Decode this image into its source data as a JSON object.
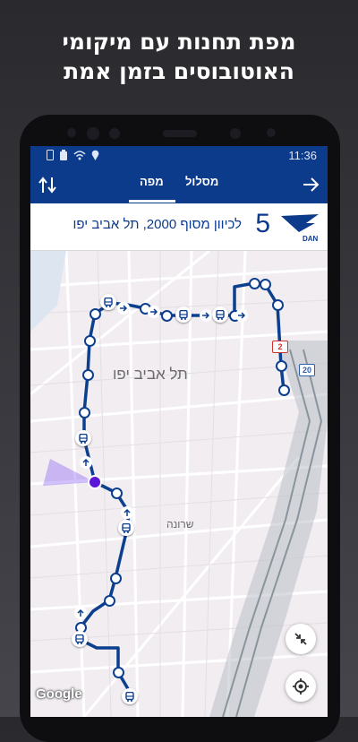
{
  "promo": {
    "line1": "מפת תחנות עם מיקומי",
    "line2": "האוטובוסים בזמן אמת"
  },
  "statusbar": {
    "time": "11:36"
  },
  "appbar": {
    "tab_map": "מפה",
    "tab_route": "מסלול"
  },
  "route": {
    "number": "5",
    "destination": "לכיוון מסוף 2000, תל אביב יפו",
    "operator": "DAN"
  },
  "map": {
    "city": "תל אביב יפו",
    "neighborhood": "שרונה",
    "highway_shields": [
      "2",
      "20"
    ],
    "attribution": "Google"
  },
  "colors": {
    "brand": "#0c3b8c",
    "route_line": "#0d3f8f",
    "user_location": "#5b16d8"
  },
  "icons": [
    "swap-direction-icon",
    "forward-arrow-icon",
    "operator-logo-icon",
    "bus-stop-icon",
    "collapse-icon",
    "my-location-icon"
  ]
}
